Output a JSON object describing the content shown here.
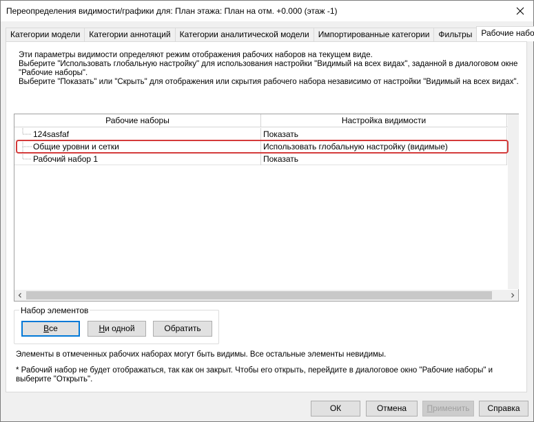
{
  "window": {
    "title": "Переопределения видимости/графики для: План этажа: План на отм. +0.000 (этаж -1)"
  },
  "tabs": [
    {
      "label": "Категории модели"
    },
    {
      "label": "Категории аннотаций"
    },
    {
      "label": "Категории аналитической модели"
    },
    {
      "label": "Импортированные категории"
    },
    {
      "label": "Фильтры"
    },
    {
      "label": "Рабочие наборы"
    }
  ],
  "info_lines": [
    "Эти параметры видимости определяют режим отображения рабочих наборов на текущем виде.",
    "Выберите \"Использовать глобальную настройку\" для использования настройки \"Видимый на всех видах\", заданной в диалоговом окне",
    "\"Рабочие наборы\".",
    "Выберите \"Показать\" или \"Скрыть\" для отображения или скрытия рабочего набора независимо от настройки \"Видимый на всех видах\"."
  ],
  "grid": {
    "columns": [
      "Рабочие наборы",
      "Настройка видимости"
    ],
    "rows": [
      {
        "name": "124sasfaf",
        "visibility": "Показать"
      },
      {
        "name": "Общие уровни и сетки",
        "visibility": "Использовать глобальную настройку (видимые)"
      },
      {
        "name": "Рабочий набор 1",
        "visibility": "Показать"
      }
    ]
  },
  "selection_group": {
    "label": "Набор элементов",
    "all": {
      "mnemonic": "В",
      "rest": "се"
    },
    "none": {
      "mnemonic": "Н",
      "rest": "и одной"
    },
    "invert": "Обратить"
  },
  "notes": {
    "line1": "Элементы в отмеченных рабочих наборах могут быть видимы.  Все остальные элементы невидимы.",
    "line2": "* Рабочий набор не будет отображаться, так как он закрыт. Чтобы его открыть, перейдите в диалоговое окно \"Рабочие наборы\" и",
    "line3": "выберите \"Открыть\"."
  },
  "footer": {
    "ok": "ОК",
    "cancel": "Отмена",
    "apply": {
      "mnemonic": "П",
      "rest": "рименить"
    },
    "help": "Справка"
  },
  "colors": {
    "highlight": "#d43a3a",
    "default_button_border": "#0078d7"
  }
}
